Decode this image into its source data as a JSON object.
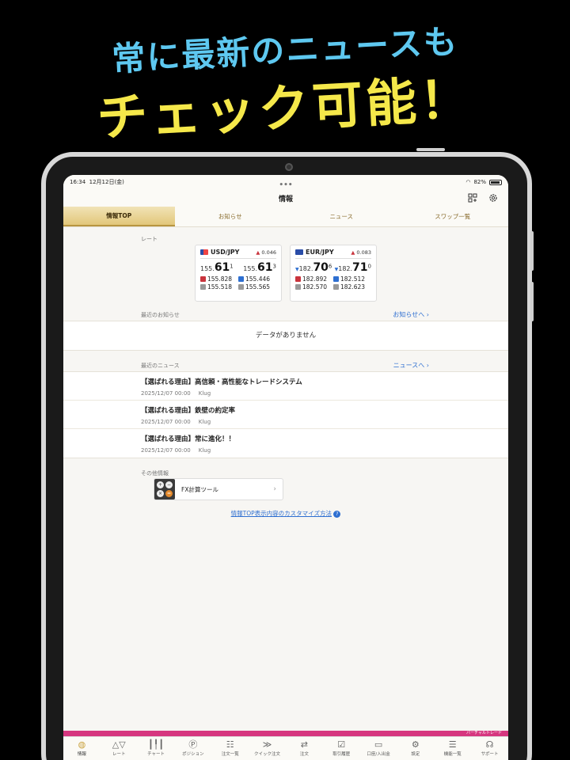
{
  "promo": {
    "line1": "常に最新のニュースも",
    "line2": "チェック可能！"
  },
  "status_bar": {
    "time": "16:34",
    "date": "12月12日(金)",
    "battery": "82%"
  },
  "header": {
    "title": "情報"
  },
  "tabs": [
    {
      "label": "情報TOP",
      "active": true
    },
    {
      "label": "お知らせ",
      "active": false
    },
    {
      "label": "ニュース",
      "active": false
    },
    {
      "label": "スワップ一覧",
      "active": false
    }
  ],
  "rates": {
    "label": "レート",
    "cards": [
      {
        "pair": "USD/JPY",
        "change": "0.046",
        "bid_prefix": "155.",
        "bid_main": "61",
        "bid_sup": "1",
        "ask_prefix": "155.",
        "ask_main": "61",
        "ask_sup": "3",
        "high_bid": "155.828",
        "low_bid": "155.446",
        "open": "155.518",
        "close": "155.565",
        "arrows": false
      },
      {
        "pair": "EUR/JPY",
        "change": "0.083",
        "bid_prefix": "182.",
        "bid_main": "70",
        "bid_sup": "6",
        "ask_prefix": "182.",
        "ask_main": "71",
        "ask_sup": "0",
        "high_bid": "182.892",
        "low_bid": "182.512",
        "open": "182.570",
        "close": "182.623",
        "arrows": true
      }
    ]
  },
  "notices": {
    "label": "最近のお知らせ",
    "more": "お知らせへ",
    "empty": "データがありません"
  },
  "news": {
    "label": "最近のニュース",
    "more": "ニュースへ",
    "items": [
      {
        "title": "【選ばれる理由】高信頼・高性能なトレードシステム",
        "date": "2025/12/07 00:00",
        "source": "Klug"
      },
      {
        "title": "【選ばれる理由】鉄壁の約定率",
        "date": "2025/12/07 00:00",
        "source": "Klug"
      },
      {
        "title": "【選ばれる理由】常に進化！！",
        "date": "2025/12/07 00:00",
        "source": "Klug"
      }
    ]
  },
  "other": {
    "label": "その他情報",
    "tool": "FX計算ツール",
    "customize": "情報TOP表示内容のカスタマイズ方法"
  },
  "virtual_trade": "バーチャルトレード",
  "bottom_nav": [
    {
      "label": "情報",
      "icon": "globe-icon",
      "glyph": "◍",
      "active": true
    },
    {
      "label": "レート",
      "icon": "rate-icon",
      "glyph": "△▽",
      "active": false
    },
    {
      "label": "チャート",
      "icon": "chart-icon",
      "glyph": "┃╿┃",
      "active": false
    },
    {
      "label": "ポジション",
      "icon": "position-icon",
      "glyph": "Ⓟ",
      "active": false
    },
    {
      "label": "注文一覧",
      "icon": "order-list-icon",
      "glyph": "☷",
      "active": false
    },
    {
      "label": "クイック注文",
      "icon": "quick-order-icon",
      "glyph": "≫",
      "active": false
    },
    {
      "label": "注文",
      "icon": "order-icon",
      "glyph": "⇄",
      "active": false
    },
    {
      "label": "取引履歴",
      "icon": "history-icon",
      "glyph": "☑",
      "active": false
    },
    {
      "label": "口座/入出金",
      "icon": "account-icon",
      "glyph": "▭",
      "active": false
    },
    {
      "label": "設定",
      "icon": "settings-icon",
      "glyph": "⚙",
      "active": false
    },
    {
      "label": "機能一覧",
      "icon": "menu-icon",
      "glyph": "☰",
      "active": false
    },
    {
      "label": "サポート",
      "icon": "support-icon",
      "glyph": "☊",
      "active": false
    }
  ]
}
